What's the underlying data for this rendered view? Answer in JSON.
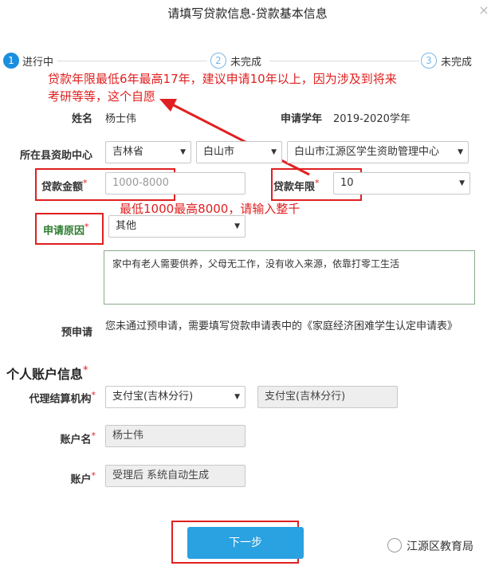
{
  "dialog": {
    "title": "请填写贷款信息-贷款基本信息",
    "close": "×"
  },
  "steps": [
    {
      "num": "1",
      "label": "进行中"
    },
    {
      "num": "2",
      "label": "未完成"
    },
    {
      "num": "3",
      "label": "未完成"
    }
  ],
  "annotations": {
    "top_line1": "贷款年限最低6年最高17年，建议申请10年以上，因为涉及到将来",
    "top_line2": "考研等等，这个自愿",
    "amount_note": "最低1000最高8000，请输入整千"
  },
  "form": {
    "name_label": "姓名",
    "name_value": "杨士伟",
    "year_label": "申请学年",
    "year_value": "2019-2020学年",
    "center_label": "所在县资助中心",
    "province": "吉林省",
    "city": "白山市",
    "center": "白山市江源区学生资助管理中心",
    "amount_label": "贷款金额",
    "amount_placeholder": "1000-8000",
    "term_label": "贷款年限",
    "term_value": "10",
    "reason_label": "申请原因",
    "reason_value": "其他",
    "reason_text": "家中有老人需要供养，父母无工作，没有收入来源，依靠打零工生活",
    "pre_label": "预申请",
    "pre_text": "您未通过预申请，需要填写贷款申请表中的《家庭经济困难学生认定申请表》",
    "req_mark": "*"
  },
  "account": {
    "section_title": "个人账户信息",
    "agent_label": "代理结算机构",
    "agent_value": "支付宝(吉林分行)",
    "agent_readonly": "支付宝(吉林分行)",
    "holder_label": "账户名",
    "holder_value": "杨士伟",
    "number_label": "账户",
    "number_value": "受理后 系统自动生成"
  },
  "actions": {
    "next_label": "下一步"
  },
  "watermark": {
    "text": "江源区教育局"
  },
  "colors": {
    "accent": "#2aa1e0",
    "annotation": "#e02020",
    "step_active": "#1a8fdf"
  }
}
